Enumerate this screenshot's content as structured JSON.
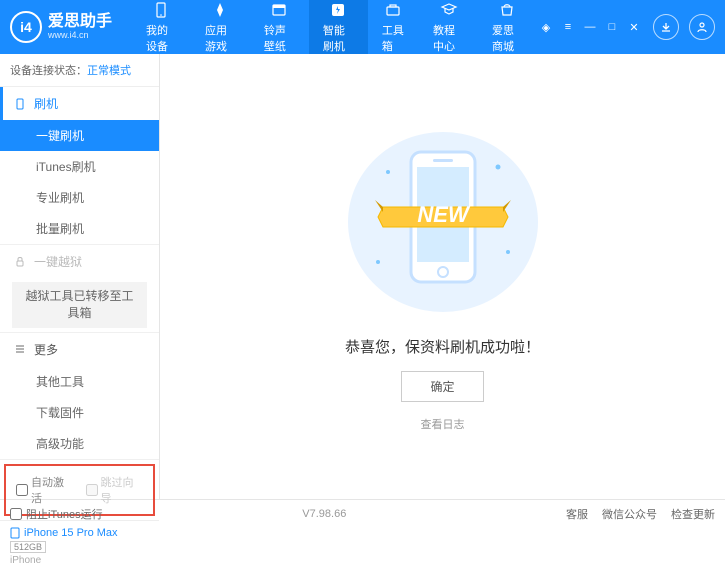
{
  "header": {
    "logo_title": "爱思助手",
    "logo_sub": "www.i4.cn",
    "nav": [
      {
        "label": "我的设备"
      },
      {
        "label": "应用游戏"
      },
      {
        "label": "铃声壁纸"
      },
      {
        "label": "智能刷机"
      },
      {
        "label": "工具箱"
      },
      {
        "label": "教程中心"
      },
      {
        "label": "爱思商城"
      }
    ]
  },
  "sidebar": {
    "status_label": "设备连接状态：",
    "status_mode": "正常模式",
    "flash_header": "刷机",
    "flash_items": [
      "一键刷机",
      "iTunes刷机",
      "专业刷机",
      "批量刷机"
    ],
    "jailbreak_header": "一键越狱",
    "jailbreak_notice": "越狱工具已转移至工具箱",
    "more_header": "更多",
    "more_items": [
      "其他工具",
      "下载固件",
      "高级功能"
    ],
    "checkbox_auto": "自动激活",
    "checkbox_skip": "跳过向导",
    "device_name": "iPhone 15 Pro Max",
    "device_storage": "512GB",
    "device_type": "iPhone"
  },
  "main": {
    "success": "恭喜您，保资料刷机成功啦！",
    "ok": "确定",
    "log": "查看日志",
    "ribbon": "NEW"
  },
  "footer": {
    "block_itunes": "阻止iTunes运行",
    "version": "V7.98.66",
    "links": [
      "客服",
      "微信公众号",
      "检查更新"
    ]
  }
}
